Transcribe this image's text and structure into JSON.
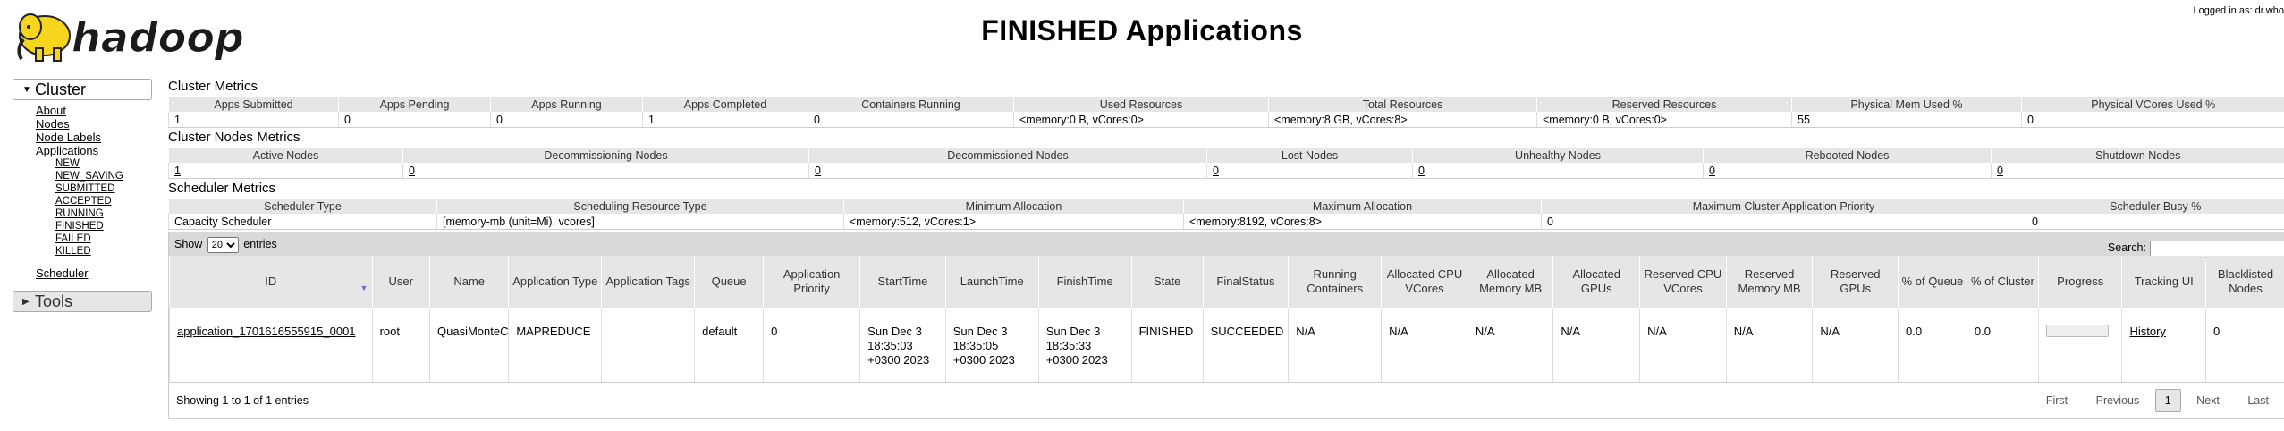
{
  "header": {
    "logo_text": "hadoop",
    "title": "FINISHED Applications",
    "logged_in": "Logged in as: dr.who"
  },
  "nav": {
    "cluster_label": "Cluster",
    "cluster_links": [
      "About",
      "Nodes",
      "Node Labels",
      "Applications"
    ],
    "app_states": [
      "NEW",
      "NEW_SAVING",
      "SUBMITTED",
      "ACCEPTED",
      "RUNNING",
      "FINISHED",
      "FAILED",
      "KILLED"
    ],
    "scheduler_label": "Scheduler",
    "tools_label": "Tools"
  },
  "cluster_metrics": {
    "title": "Cluster Metrics",
    "headers": [
      "Apps Submitted",
      "Apps Pending",
      "Apps Running",
      "Apps Completed",
      "Containers Running",
      "Used Resources",
      "Total Resources",
      "Reserved Resources",
      "Physical Mem Used %",
      "Physical VCores Used %"
    ],
    "values": [
      "1",
      "0",
      "0",
      "1",
      "0",
      "<memory:0 B, vCores:0>",
      "<memory:8 GB, vCores:8>",
      "<memory:0 B, vCores:0>",
      "55",
      "0"
    ]
  },
  "node_metrics": {
    "title": "Cluster Nodes Metrics",
    "headers": [
      "Active Nodes",
      "Decommissioning Nodes",
      "Decommissioned Nodes",
      "Lost Nodes",
      "Unhealthy Nodes",
      "Rebooted Nodes",
      "Shutdown Nodes"
    ],
    "values": [
      "1",
      "0",
      "0",
      "0",
      "0",
      "0",
      "0"
    ]
  },
  "scheduler_metrics": {
    "title": "Scheduler Metrics",
    "headers": [
      "Scheduler Type",
      "Scheduling Resource Type",
      "Minimum Allocation",
      "Maximum Allocation",
      "Maximum Cluster Application Priority",
      "Scheduler Busy %"
    ],
    "values": [
      "Capacity Scheduler",
      "[memory-mb (unit=Mi), vcores]",
      "<memory:512, vCores:1>",
      "<memory:8192, vCores:8>",
      "0",
      "0"
    ]
  },
  "apps_table": {
    "show_label": "Show",
    "entries_count": "20",
    "entries_label": "entries",
    "search_label": "Search:",
    "search_value": "",
    "headers": [
      "ID",
      "User",
      "Name",
      "Application Type",
      "Application Tags",
      "Queue",
      "Application Priority",
      "StartTime",
      "LaunchTime",
      "FinishTime",
      "State",
      "FinalStatus",
      "Running Containers",
      "Allocated CPU VCores",
      "Allocated Memory MB",
      "Allocated GPUs",
      "Reserved CPU VCores",
      "Reserved Memory MB",
      "Reserved GPUs",
      "% of Queue",
      "% of Cluster",
      "Progress",
      "Tracking UI",
      "Blacklisted Nodes"
    ],
    "rows": [
      {
        "id": "application_1701616555915_0001",
        "user": "root",
        "name": "QuasiMonteCarlo",
        "type": "MAPREDUCE",
        "tags": "",
        "queue": "default",
        "priority": "0",
        "start": "Sun Dec 3 18:35:03 +0300 2023",
        "launch": "Sun Dec 3 18:35:05 +0300 2023",
        "finish": "Sun Dec 3 18:35:33 +0300 2023",
        "state": "FINISHED",
        "final_status": "SUCCEEDED",
        "running_containers": "N/A",
        "alloc_cpu": "N/A",
        "alloc_mem": "N/A",
        "alloc_gpu": "N/A",
        "res_cpu": "N/A",
        "res_mem": "N/A",
        "res_gpu": "N/A",
        "pct_queue": "0.0",
        "pct_cluster": "0.0",
        "progress": 0,
        "tracking": "History",
        "blacklisted": "0"
      }
    ],
    "info": "Showing 1 to 1 of 1 entries",
    "pager": {
      "first": "First",
      "previous": "Previous",
      "current": "1",
      "next": "Next",
      "last": "Last"
    }
  }
}
